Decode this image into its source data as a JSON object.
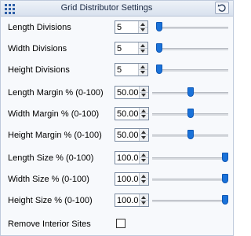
{
  "title": "Grid Distributor Settings",
  "icons": {
    "app": "grid-icon",
    "reset": "reset-icon"
  },
  "accent": "#1a72d9",
  "fields": [
    {
      "label": "Length Divisions",
      "value": "5",
      "slider_fraction": 0.0
    },
    {
      "label": "Width Divisions",
      "value": "5",
      "slider_fraction": 0.0
    },
    {
      "label": "Height Divisions",
      "value": "5",
      "slider_fraction": 0.0
    },
    {
      "label": "Length Margin % (0-100)",
      "value": "50.00",
      "slider_fraction": 0.5
    },
    {
      "label": "Width Margin % (0-100)",
      "value": "50.00",
      "slider_fraction": 0.5
    },
    {
      "label": "Height Margin % (0-100)",
      "value": "50.00",
      "slider_fraction": 0.5
    },
    {
      "label": "Length Size % (0-100)",
      "value": "100.0",
      "slider_fraction": 1.0
    },
    {
      "label": "Width Size % (0-100)",
      "value": "100.0",
      "slider_fraction": 1.0
    },
    {
      "label": "Height Size % (0-100)",
      "value": "100.0",
      "slider_fraction": 1.0
    }
  ],
  "remove_interior_sites": {
    "label": "Remove Interior Sites",
    "checked": false
  }
}
